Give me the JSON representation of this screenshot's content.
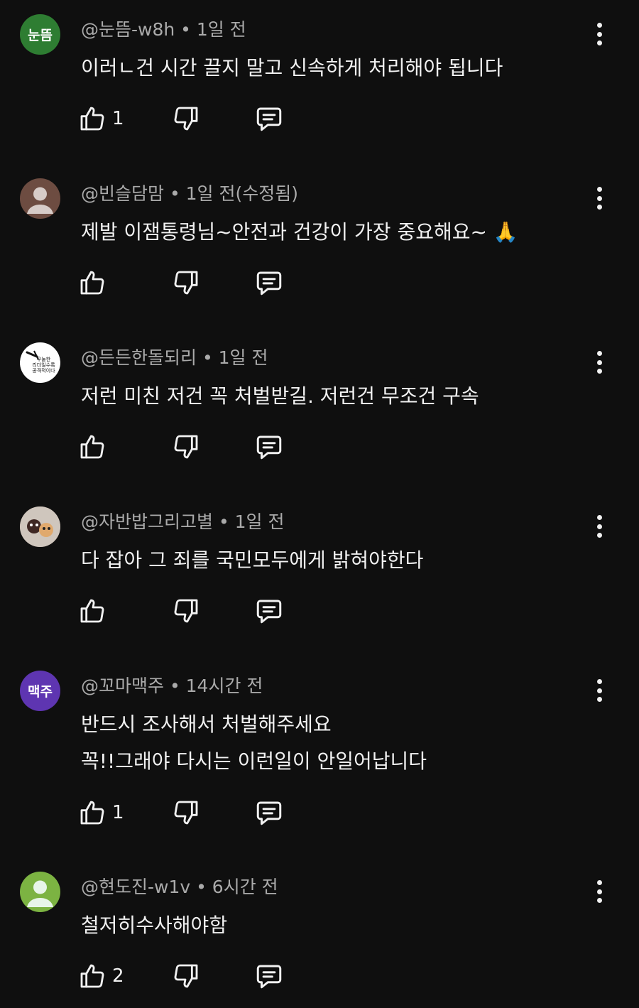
{
  "colors": {
    "background": "#0f0f0f",
    "text": "#f1f1f1",
    "meta": "#aaaaaa"
  },
  "icons": {
    "like": "thumb-up-icon",
    "dislike": "thumb-down-icon",
    "reply": "reply-comment-icon",
    "menu": "more-vert-icon"
  },
  "comments": [
    {
      "avatar_text": "눈뜸",
      "avatar_color": "#2e7d32",
      "meta": "@눈뜸-w8h • 1일 전",
      "lines": [
        "이러ㄴ건 시간 끌지 말고 신속하게 처리해야 됩니다"
      ],
      "likes": "1"
    },
    {
      "avatar_text": "",
      "avatar_color": "#6d4c41",
      "meta": "@빈슬담맘 • 1일 전(수정됨)",
      "lines": [
        "제발 이잼통령님~안전과 건강이 가장 중요해요~ 🙏"
      ],
      "likes": ""
    },
    {
      "avatar_text": "우눌한\n리더일수록\n공격적이다",
      "avatar_color": "#ffffff",
      "meta": "@든든한돌되리 • 1일 전",
      "lines": [
        "저런 미친 저건 꼭 처벌받길. 저런건 무조건 구속"
      ],
      "likes": ""
    },
    {
      "avatar_text": "",
      "avatar_color": "#8d6e63",
      "meta": "@자반밥그리고별 • 1일 전",
      "lines": [
        "다 잡아 그 죄를 국민모두에게 밝혀야한다"
      ],
      "likes": ""
    },
    {
      "avatar_text": "맥주",
      "avatar_color": "#5e35b1",
      "meta": "@꼬마맥주 • 14시간 전",
      "lines": [
        "반드시 조사해서  처벌해주세요",
        "꼭!!그래야 다시는 이런일이  안일어납니다"
      ],
      "likes": "1"
    },
    {
      "avatar_text": "",
      "avatar_color": "#7cb342",
      "meta": "@현도진-w1v • 6시간 전",
      "lines": [
        "철저히수사해야함"
      ],
      "likes": "2"
    }
  ]
}
